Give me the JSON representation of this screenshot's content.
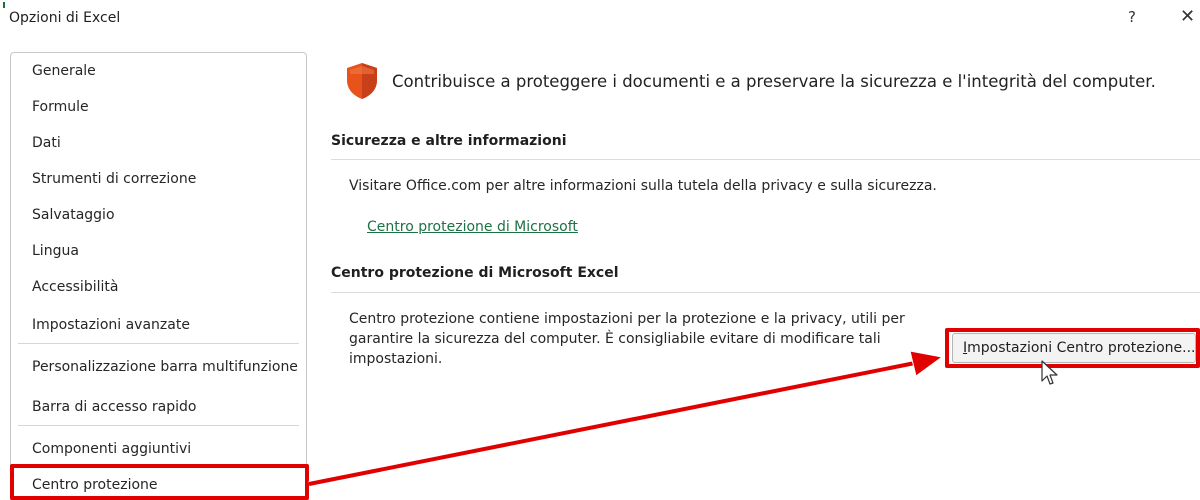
{
  "window": {
    "title": "Opzioni di Excel",
    "help_label": "?",
    "close_label": "✕"
  },
  "sidebar": {
    "items": [
      {
        "label": "Generale"
      },
      {
        "label": "Formule"
      },
      {
        "label": "Dati"
      },
      {
        "label": "Strumenti di correzione"
      },
      {
        "label": "Salvataggio"
      },
      {
        "label": "Lingua"
      },
      {
        "label": "Accessibilità"
      },
      {
        "label": "Impostazioni avanzate"
      },
      {
        "label": "Personalizzazione barra multifunzione"
      },
      {
        "label": "Barra di accesso rapido"
      },
      {
        "label": "Componenti aggiuntivi"
      },
      {
        "label": "Centro protezione"
      }
    ],
    "selected": "Centro protezione"
  },
  "main": {
    "intro": "Contribuisce a proteggere i documenti e a preservare la sicurezza e l'integrità del computer.",
    "shield_icon": "shield-icon",
    "sections": [
      {
        "title": "Sicurezza e altre informazioni",
        "text": "Visitare Office.com per altre informazioni sulla tutela della privacy e sulla sicurezza.",
        "link": "Centro protezione di Microsoft"
      },
      {
        "title": "Centro protezione di Microsoft Excel",
        "text": "Centro protezione contiene impostazioni per la protezione e la privacy, utili per garantire la sicurezza del computer. È consigliabile evitare di modificare tali impostazioni.",
        "button_accel": "I",
        "button_rest": "mpostazioni Centro protezione..."
      }
    ]
  },
  "colors": {
    "highlight": "#e00000",
    "link": "#1e7145",
    "shield": "#e8531c"
  }
}
